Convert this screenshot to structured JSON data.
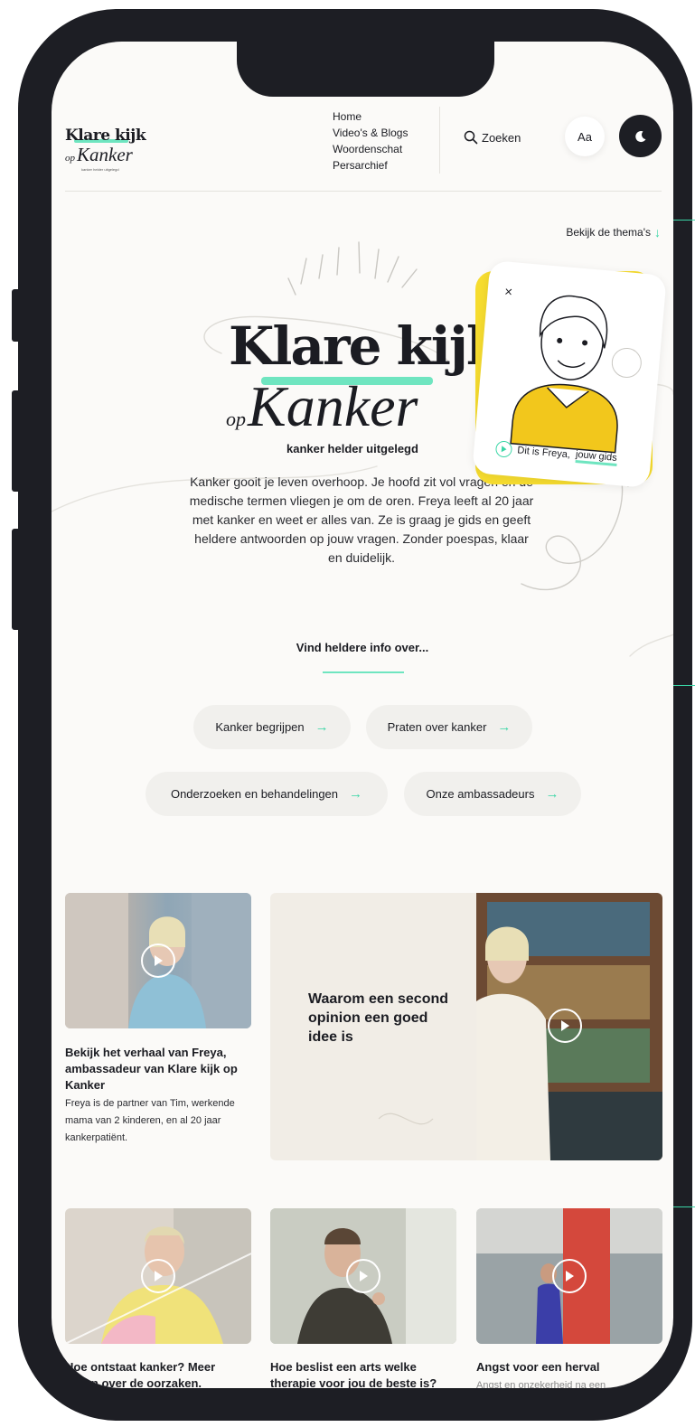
{
  "logo": {
    "line1": "Klare kijk",
    "op": "op",
    "line2": "Kanker",
    "tagline": "kanker helder uitgelegd"
  },
  "nav": {
    "items": [
      "Home",
      "Video's & Blogs",
      "Woordenschat",
      "Persarchief"
    ]
  },
  "search": {
    "label": "Zoeken",
    "icon": "search-icon"
  },
  "font_toggle": {
    "label": "Aa"
  },
  "theme_toggle": {
    "icon": "moon-icon"
  },
  "themas_link": {
    "label": "Bekijk de thema's",
    "arrow": "↓"
  },
  "hero": {
    "title": "Klare kijk",
    "op": "op",
    "subtitle": "Kanker",
    "tagline": "kanker helder uitgelegd",
    "description": "Kanker gooit je leven overhoop. Je hoofd zit vol vragen en de medische termen vliegen je om de oren. Freya leeft al 20 jaar met kanker en weet er alles van. Ze is graag je gids en geeft heldere antwoorden op jouw vragen. Zonder poespas, klaar en duidelijk."
  },
  "guide_card": {
    "caption_prefix": "Dit is Freya,",
    "caption_highlight": "jouw gids"
  },
  "topics": {
    "heading": "Vind heldere info over...",
    "items": [
      "Kanker begrijpen",
      "Praten over kanker",
      "Onderzoeken en behandelingen",
      "Onze ambassadeurs"
    ],
    "arrow": "→"
  },
  "videos": {
    "v1": {
      "title": "Bekijk het verhaal van Freya, ambassadeur van Klare kijk op Kanker",
      "desc": "Freya is de partner van Tim, werkende mama van 2 kinderen, en al 20 jaar kankerpatiënt."
    },
    "featured": {
      "title": "Waarom een second opinion een goed idee is"
    },
    "v3": {
      "title": "Hoe ontstaat kanker? Meer weten over de oorzaken."
    },
    "v4": {
      "title": "Hoe beslist een arts welke therapie voor jou de beste is?"
    },
    "v5": {
      "title": "Angst voor een herval",
      "desc": "Angst en onzekerheid na een"
    }
  },
  "colors": {
    "accent": "#3ad6a6",
    "highlight": "#6fe5c0",
    "yellow": "#f6dc2f",
    "dark": "#1d1e24",
    "bg": "#fbfaf8"
  }
}
